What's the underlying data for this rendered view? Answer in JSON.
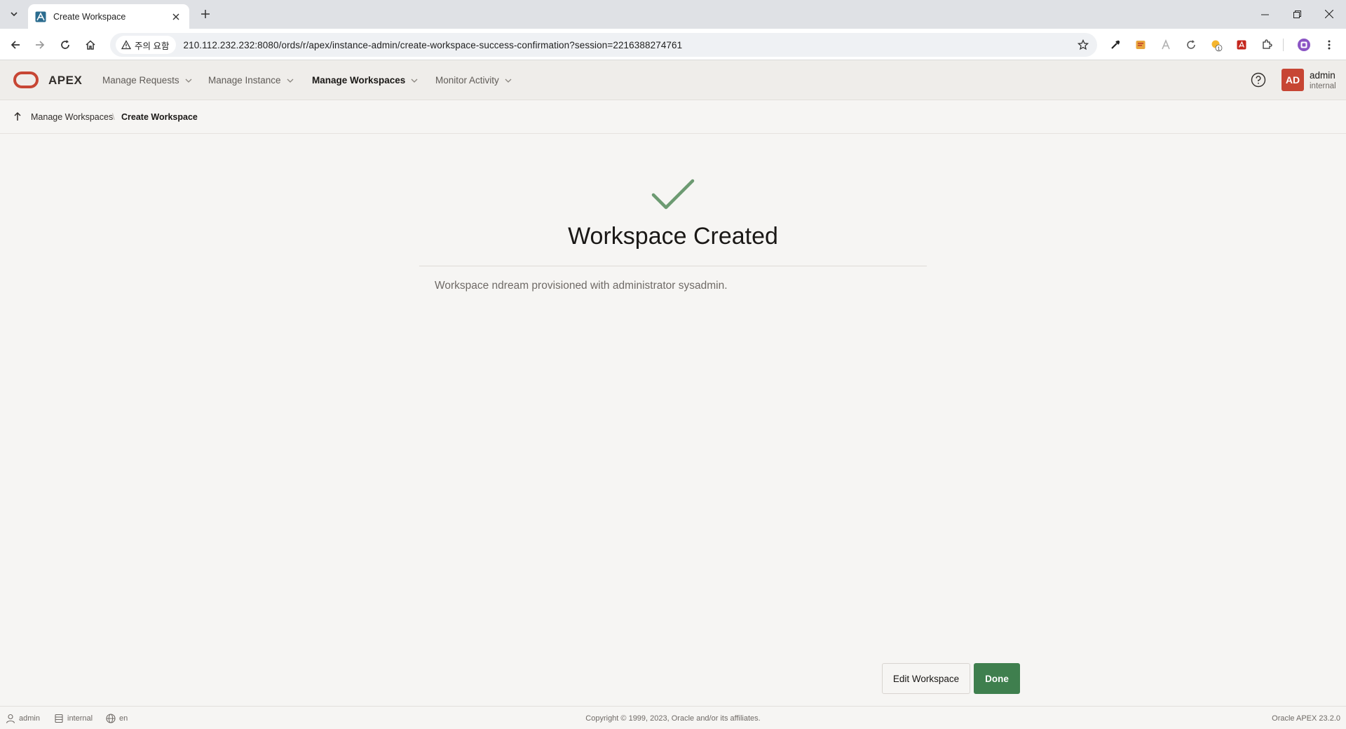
{
  "browser": {
    "tab_title": "Create Workspace",
    "security_label": "주의 요함",
    "url": "210.112.232.232:8080/ords/r/apex/instance-admin/create-workspace-success-confirmation?session=2216388274761",
    "extension_badge": "1"
  },
  "header": {
    "app_name": "APEX",
    "nav": [
      {
        "label": "Manage Requests"
      },
      {
        "label": "Manage Instance"
      },
      {
        "label": "Manage Workspaces"
      },
      {
        "label": "Monitor Activity"
      }
    ],
    "user_initials": "AD",
    "user_name": "admin",
    "user_workspace": "internal"
  },
  "breadcrumb": {
    "parent": "Manage Workspaces",
    "current": "Create Workspace"
  },
  "main": {
    "title": "Workspace Created",
    "message": "Workspace ndream provisioned with administrator sysadmin.",
    "edit_button": "Edit Workspace",
    "done_button": "Done"
  },
  "footer": {
    "user": "admin",
    "workspace": "internal",
    "language": "en",
    "copyright": "Copyright © 1999, 2023, Oracle and/or its affiliates.",
    "version": "Oracle APEX 23.2.0"
  },
  "colors": {
    "brand_red": "#c74634",
    "success_green": "#3f7f4e",
    "check_green": "#6c9a71"
  }
}
